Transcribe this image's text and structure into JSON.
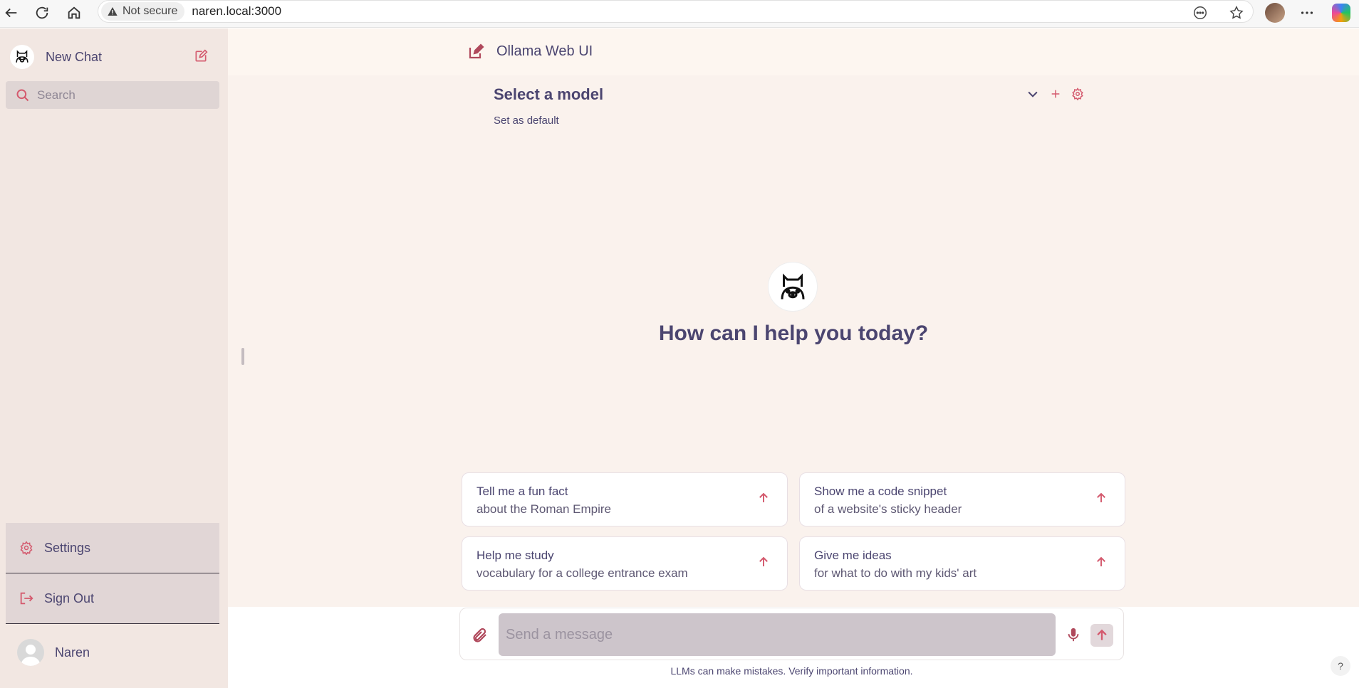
{
  "browser": {
    "security_label": "Not secure",
    "url": "naren.local:3000"
  },
  "sidebar": {
    "new_chat_label": "New Chat",
    "search_placeholder": "Search",
    "settings_label": "Settings",
    "signout_label": "Sign Out",
    "user_name": "Naren"
  },
  "header": {
    "title": "Ollama Web UI"
  },
  "model": {
    "select_label": "Select a model",
    "set_default_label": "Set as default"
  },
  "hero": {
    "greeting": "How can I help you today?"
  },
  "suggestions": [
    {
      "title": "Tell me a fun fact",
      "subtitle": "about the Roman Empire"
    },
    {
      "title": "Show me a code snippet",
      "subtitle": "of a website's sticky header"
    },
    {
      "title": "Help me study",
      "subtitle": "vocabulary for a college entrance exam"
    },
    {
      "title": "Give me ideas",
      "subtitle": "for what to do with my kids' art"
    }
  ],
  "composer": {
    "placeholder": "Send a message",
    "disclaimer": "LLMs can make mistakes. Verify important information."
  },
  "help": {
    "label": "?"
  },
  "colors": {
    "accent": "#d45a6e",
    "text": "#4b4570",
    "sidebar_bg": "#f2e7e2",
    "main_bg": "#faf2ed"
  }
}
